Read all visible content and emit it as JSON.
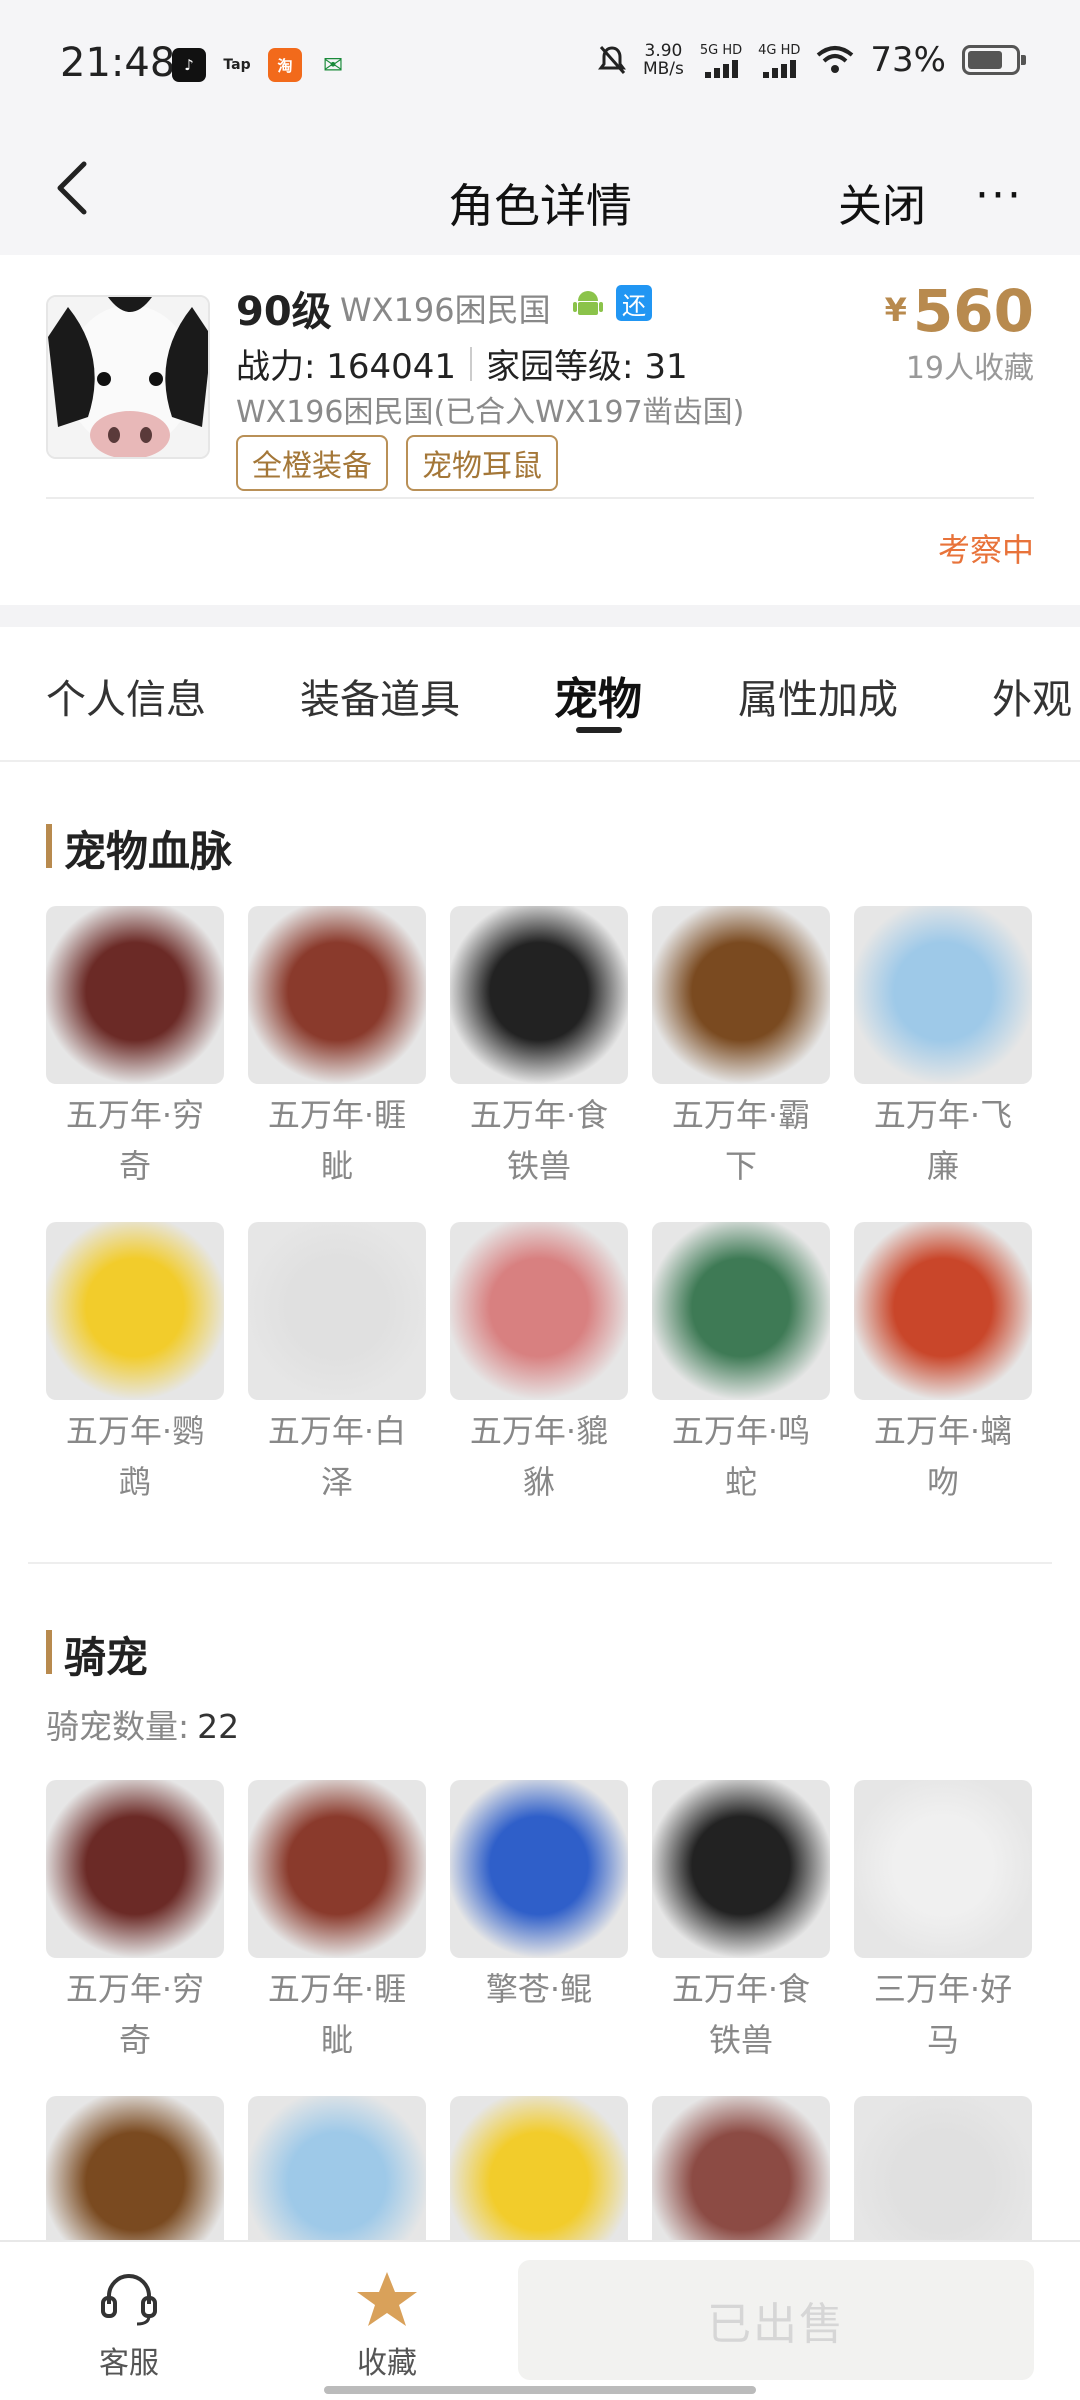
{
  "status_bar": {
    "time": "21:48",
    "net_speed": "3.90",
    "net_unit": "MB/s",
    "sig1": "5G HD",
    "sig2": "4G HD",
    "battery": "73%",
    "battery_level": 0.73,
    "app_icons": [
      "tiktok-icon",
      "tap-icon",
      "taobao-icon",
      "post-icon"
    ],
    "tap_label": "Tap",
    "taobao_label": "淘"
  },
  "header": {
    "title": "角色详情",
    "close_label": "关闭",
    "more_label": "···"
  },
  "character": {
    "level": "90级",
    "server": "WX196困民国",
    "return_badge": "还",
    "power": "战力: 164041",
    "home_level": "家园等级: 31",
    "server_full": "WX196困民国(已合入WX197凿齿国)",
    "tags": [
      "全橙装备",
      "宠物耳鼠"
    ],
    "price_currency": "¥",
    "price": "560",
    "favorites": "19人收藏",
    "status": "考察中"
  },
  "tabs": [
    "个人信息",
    "装备道具",
    "宠物",
    "属性加成",
    "外观"
  ],
  "active_tab": "宠物",
  "bloodline": {
    "title": "宠物血脉",
    "pets": [
      {
        "name": "五万年·穷奇",
        "line1": "五万年·穷",
        "line2": "奇",
        "color": "#6b2a26"
      },
      {
        "name": "五万年·睚眦",
        "line1": "五万年·睚",
        "line2": "眦",
        "color": "#8a3a2c"
      },
      {
        "name": "五万年·食铁兽",
        "line1": "五万年·食",
        "line2": "铁兽",
        "color": "#222222"
      },
      {
        "name": "五万年·霸下",
        "line1": "五万年·霸",
        "line2": "下",
        "color": "#7a4a20"
      },
      {
        "name": "五万年·飞廉",
        "line1": "五万年·飞",
        "line2": "廉",
        "color": "#9ec9e8"
      },
      {
        "name": "五万年·鹦鹉",
        "line1": "五万年·鹦",
        "line2": "鹉",
        "color": "#f2cc2b"
      },
      {
        "name": "五万年·白泽",
        "line1": "五万年·白",
        "line2": "泽",
        "color": "#e0e0e0"
      },
      {
        "name": "五万年·貔貅",
        "line1": "五万年·貔",
        "line2": "貅",
        "color": "#d88080"
      },
      {
        "name": "五万年·鸣蛇",
        "line1": "五万年·鸣",
        "line2": "蛇",
        "color": "#3e7a55"
      },
      {
        "name": "五万年·螭吻",
        "line1": "五万年·螭",
        "line2": "吻",
        "color": "#c9462a"
      }
    ]
  },
  "mounts": {
    "title": "骑宠",
    "count_label": "骑宠数量:",
    "count": "22",
    "pets": [
      {
        "name": "五万年·穷奇",
        "line1": "五万年·穷",
        "line2": "奇",
        "color": "#6b2a26"
      },
      {
        "name": "五万年·睚眦",
        "line1": "五万年·睚",
        "line2": "眦",
        "color": "#8a3a2c"
      },
      {
        "name": "擎苍·鲲",
        "line1": "擎苍·鲲",
        "line2": "",
        "color": "#2f5fc9"
      },
      {
        "name": "五万年·食铁兽",
        "line1": "五万年·食",
        "line2": "铁兽",
        "color": "#222222"
      },
      {
        "name": "三万年·好马",
        "line1": "三万年·好",
        "line2": "马",
        "color": "#f0f0f0"
      },
      {
        "name": "",
        "line1": "",
        "line2": "",
        "color": "#7a4a20"
      },
      {
        "name": "",
        "line1": "",
        "line2": "",
        "color": "#9ec9e8"
      },
      {
        "name": "",
        "line1": "",
        "line2": "",
        "color": "#f2cc2b"
      },
      {
        "name": "",
        "line1": "",
        "line2": "",
        "color": "#8c4b44"
      },
      {
        "name": "",
        "line1": "",
        "line2": "",
        "color": "#e0e0e0"
      }
    ]
  },
  "bottom_bar": {
    "service_label": "客服",
    "favorite_label": "收藏",
    "sold_label": "已出售"
  },
  "colors": {
    "accent_gold": "#b88a4e",
    "status_orange": "#e8733a",
    "fav_star": "#d9a15a"
  }
}
